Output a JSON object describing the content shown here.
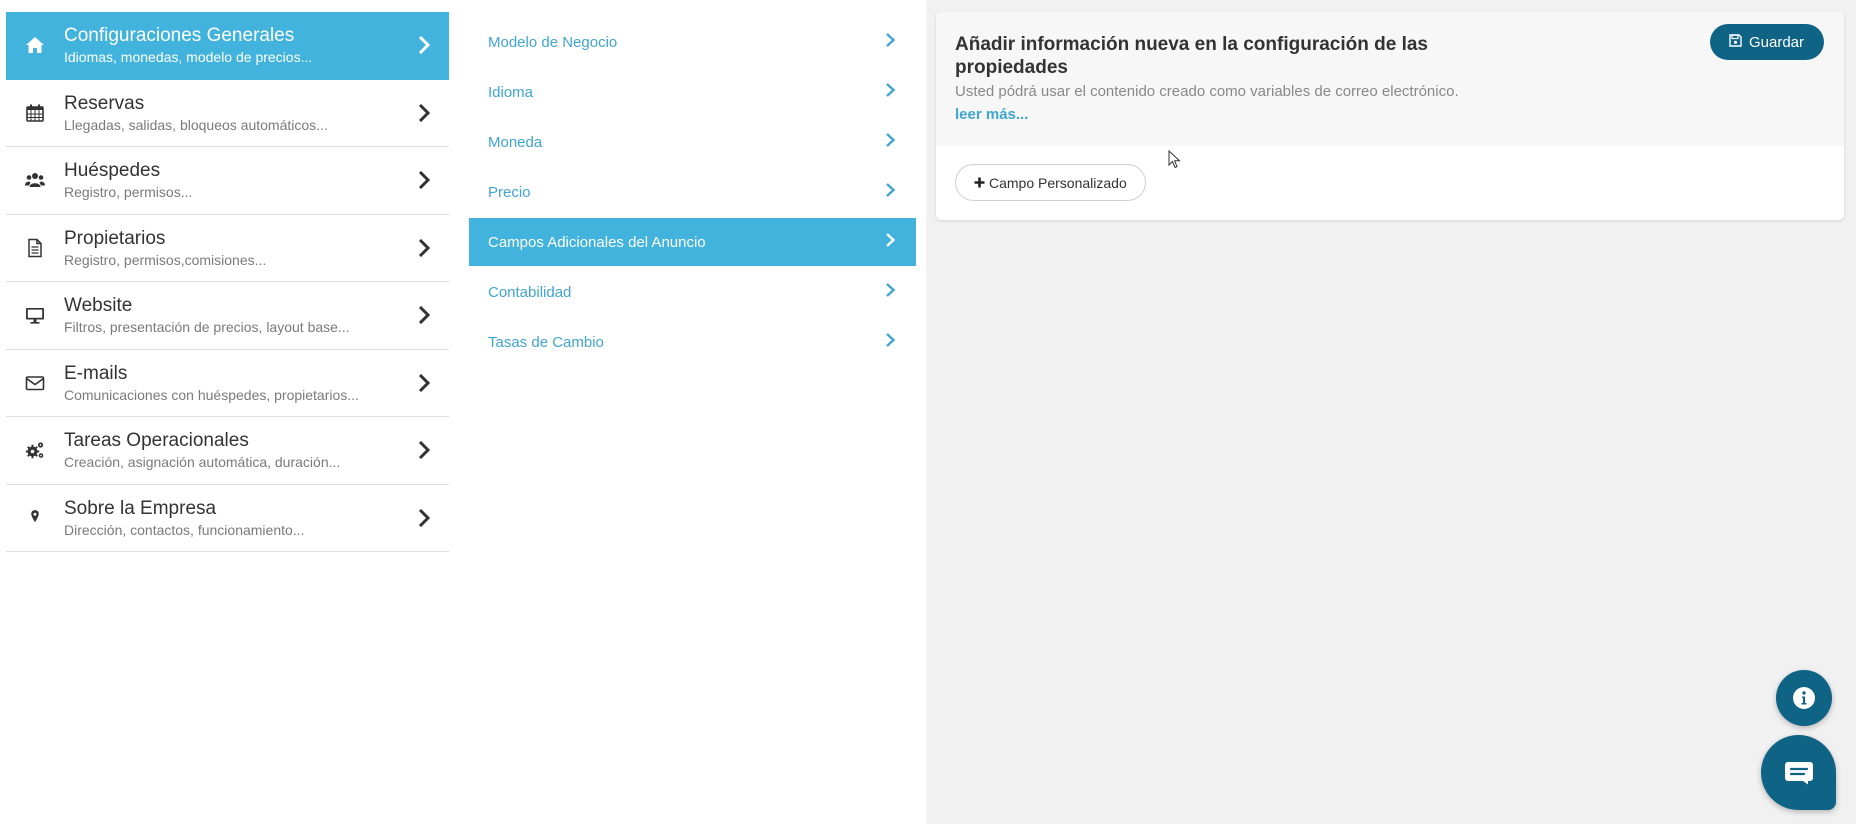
{
  "left_menu": [
    {
      "title": "Configuraciones Generales",
      "subtitle": "Idiomas, monedas, modelo de precios...",
      "icon": "home-icon",
      "active": true
    },
    {
      "title": "Reservas",
      "subtitle": "Llegadas, salidas, bloqueos automáticos...",
      "icon": "calendar-icon",
      "active": false
    },
    {
      "title": "Huéspedes",
      "subtitle": "Registro, permisos...",
      "icon": "users-icon",
      "active": false
    },
    {
      "title": "Propietarios",
      "subtitle": "Registro, permisos,comisiones...",
      "icon": "document-icon",
      "active": false
    },
    {
      "title": "Website",
      "subtitle": "Filtros, presentación de precios, layout base...",
      "icon": "monitor-icon",
      "active": false
    },
    {
      "title": "E-mails",
      "subtitle": "Comunicaciones con huéspedes, propietarios...",
      "icon": "envelope-icon",
      "active": false
    },
    {
      "title": "Tareas Operacionales",
      "subtitle": "Creación, asignación automática, duración...",
      "icon": "gears-icon",
      "active": false
    },
    {
      "title": "Sobre la Empresa",
      "subtitle": "Dirección, contactos, funcionamiento...",
      "icon": "map-marker-icon",
      "active": false
    }
  ],
  "sub_menu": [
    {
      "label": "Modelo de Negocio",
      "active": false
    },
    {
      "label": "Idioma",
      "active": false
    },
    {
      "label": "Moneda",
      "active": false
    },
    {
      "label": "Precio",
      "active": false
    },
    {
      "label": "Campos Adicionales del Anuncio",
      "active": true
    },
    {
      "label": "Contabilidad",
      "active": false
    },
    {
      "label": "Tasas de Cambio",
      "active": false
    }
  ],
  "panel": {
    "title": "Añadir información nueva en la configuración de las propiedades",
    "description": "Usted pódrá usar el contenido creado como variables de correo electrónico.",
    "read_more": "leer más...",
    "save_label": "Guardar",
    "custom_field_label": "Campo Personalizado"
  },
  "colors": {
    "accent": "#41b3dc",
    "link": "#41a5d2",
    "primary_dark": "#0f6385",
    "background": "#f1f1f1"
  }
}
